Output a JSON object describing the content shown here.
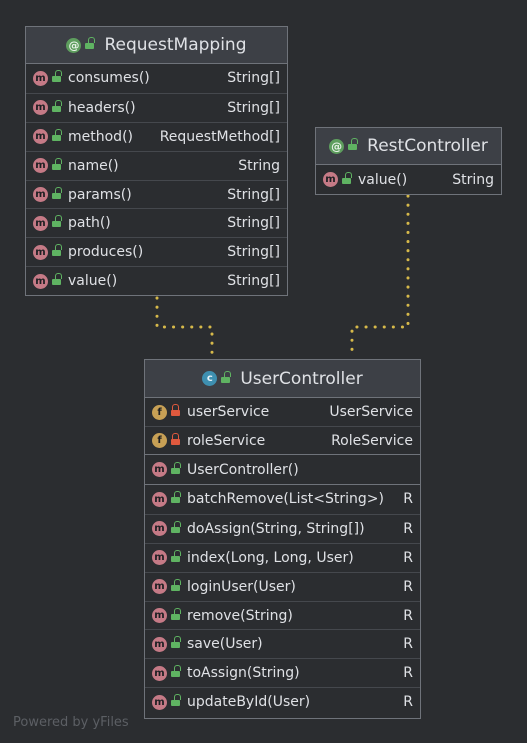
{
  "classes": {
    "request_mapping": {
      "name": "RequestMapping",
      "icon": "annotation-icon",
      "members": [
        {
          "name": "consumes()",
          "type": "String[]"
        },
        {
          "name": "headers()",
          "type": "String[]"
        },
        {
          "name": "method()",
          "type": "RequestMethod[]"
        },
        {
          "name": "name()",
          "type": "String"
        },
        {
          "name": "params()",
          "type": "String[]"
        },
        {
          "name": "path()",
          "type": "String[]"
        },
        {
          "name": "produces()",
          "type": "String[]"
        },
        {
          "name": "value()",
          "type": "String[]"
        }
      ]
    },
    "rest_controller": {
      "name": "RestController",
      "icon": "annotation-icon",
      "members": [
        {
          "name": "value()",
          "type": "String"
        }
      ]
    },
    "user_controller": {
      "name": "UserController",
      "icon": "class-icon",
      "fields": [
        {
          "name": "userService",
          "type": "UserService"
        },
        {
          "name": "roleService",
          "type": "RoleService"
        }
      ],
      "constructors": [
        {
          "name": "UserController()"
        }
      ],
      "methods": [
        {
          "name": "batchRemove(List<String>)",
          "type": "R"
        },
        {
          "name": "doAssign(String, String[])",
          "type": "R"
        },
        {
          "name": "index(Long, Long, User)",
          "type": "R"
        },
        {
          "name": "loginUser(User)",
          "type": "R"
        },
        {
          "name": "remove(String)",
          "type": "R"
        },
        {
          "name": "save(User)",
          "type": "R"
        },
        {
          "name": "toAssign(String)",
          "type": "R"
        },
        {
          "name": "updateById(User)",
          "type": "R"
        }
      ]
    }
  },
  "edges": [
    {
      "from": "UserController",
      "to": "RequestMapping",
      "style": "dotted",
      "color": "#d6b94a"
    },
    {
      "from": "UserController",
      "to": "RestController",
      "style": "dotted",
      "color": "#d6b94a"
    }
  ],
  "icon_letters": {
    "method": "m",
    "field": "f",
    "class": "c",
    "annotation": "@"
  },
  "watermark": "Powered by yFiles",
  "colors": {
    "background": "#2b2d30",
    "header": "#3d4046",
    "border": "#6f737a",
    "edge": "#d6b94a"
  }
}
